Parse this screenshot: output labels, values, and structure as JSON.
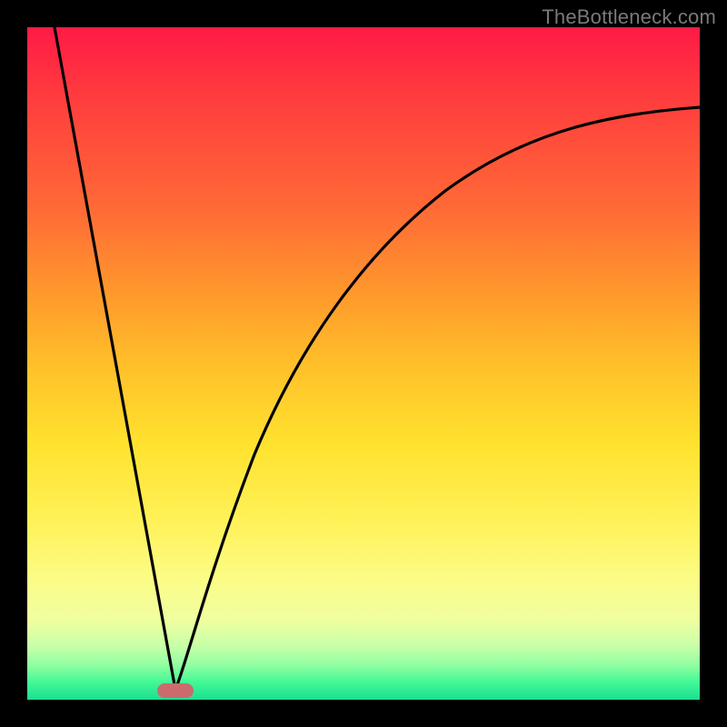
{
  "watermark": "TheBottleneck.com",
  "colors": {
    "frame": "#000000",
    "curve": "#000000",
    "marker": "#cc6b6d",
    "gradient_top": "#ff1a46",
    "gradient_bottom": "#1adf8f"
  },
  "chart_data": {
    "type": "line",
    "title": "",
    "xlabel": "",
    "ylabel": "",
    "xlim": [
      0,
      100
    ],
    "ylim": [
      0,
      100
    ],
    "grid": false,
    "legend": false,
    "marker": {
      "x": 22,
      "y": 1.5
    },
    "series": [
      {
        "name": "left-branch",
        "x": [
          4,
          6,
          8,
          10,
          12,
          14,
          16,
          18,
          20,
          21,
          22
        ],
        "values": [
          100,
          89,
          78,
          67,
          56,
          44.5,
          33.5,
          22,
          11,
          5.5,
          1.5
        ]
      },
      {
        "name": "right-branch",
        "x": [
          22,
          24,
          26,
          28,
          30,
          33,
          36,
          40,
          45,
          50,
          55,
          60,
          65,
          70,
          75,
          80,
          85,
          90,
          95,
          100
        ],
        "values": [
          1.5,
          8,
          16,
          24,
          31,
          40,
          48,
          56,
          63,
          68.5,
          72.5,
          75.8,
          78.5,
          80.6,
          82.4,
          83.9,
          85.2,
          86.2,
          87.1,
          88
        ]
      }
    ],
    "annotations": []
  }
}
